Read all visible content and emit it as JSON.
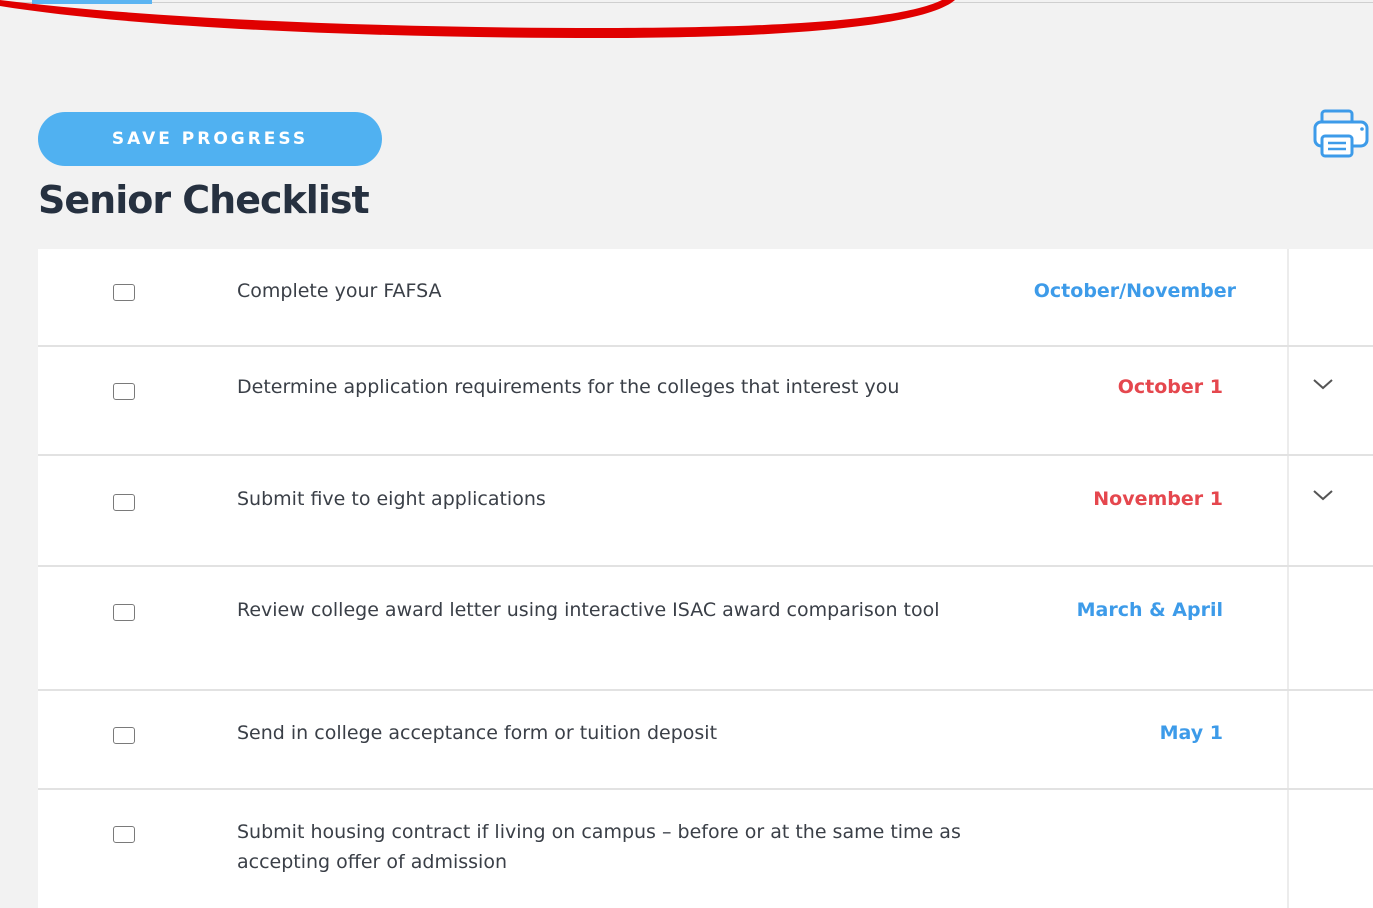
{
  "toolbar": {
    "save_label": "SAVE PROGRESS",
    "print_icon": "printer-icon"
  },
  "page_title": "Senior Checklist",
  "colors": {
    "accent": "#50b1f1",
    "date_blue": "#3d9be9",
    "date_red": "#e5474e",
    "annotation_red": "#e00000"
  },
  "checklist": [
    {
      "task": "Complete your FAFSA",
      "due": "October/November",
      "due_color": "blue",
      "checked": false,
      "expandable": false
    },
    {
      "task": "Determine application requirements for the colleges that interest you",
      "due": "October 1",
      "due_color": "red",
      "checked": false,
      "expandable": true
    },
    {
      "task": "Submit five to eight applications",
      "due": "November 1",
      "due_color": "red",
      "checked": false,
      "expandable": true
    },
    {
      "task": "Review college award letter using interactive ISAC award comparison tool",
      "due": "March & April",
      "due_color": "blue",
      "checked": false,
      "expandable": false
    },
    {
      "task": "Send in college acceptance form or tuition deposit",
      "due": "May 1",
      "due_color": "blue",
      "checked": false,
      "expandable": false
    },
    {
      "task": "Submit housing contract if living on campus – before or at the same time as accepting offer of admission",
      "due": "",
      "due_color": "blue",
      "checked": false,
      "expandable": false
    }
  ]
}
